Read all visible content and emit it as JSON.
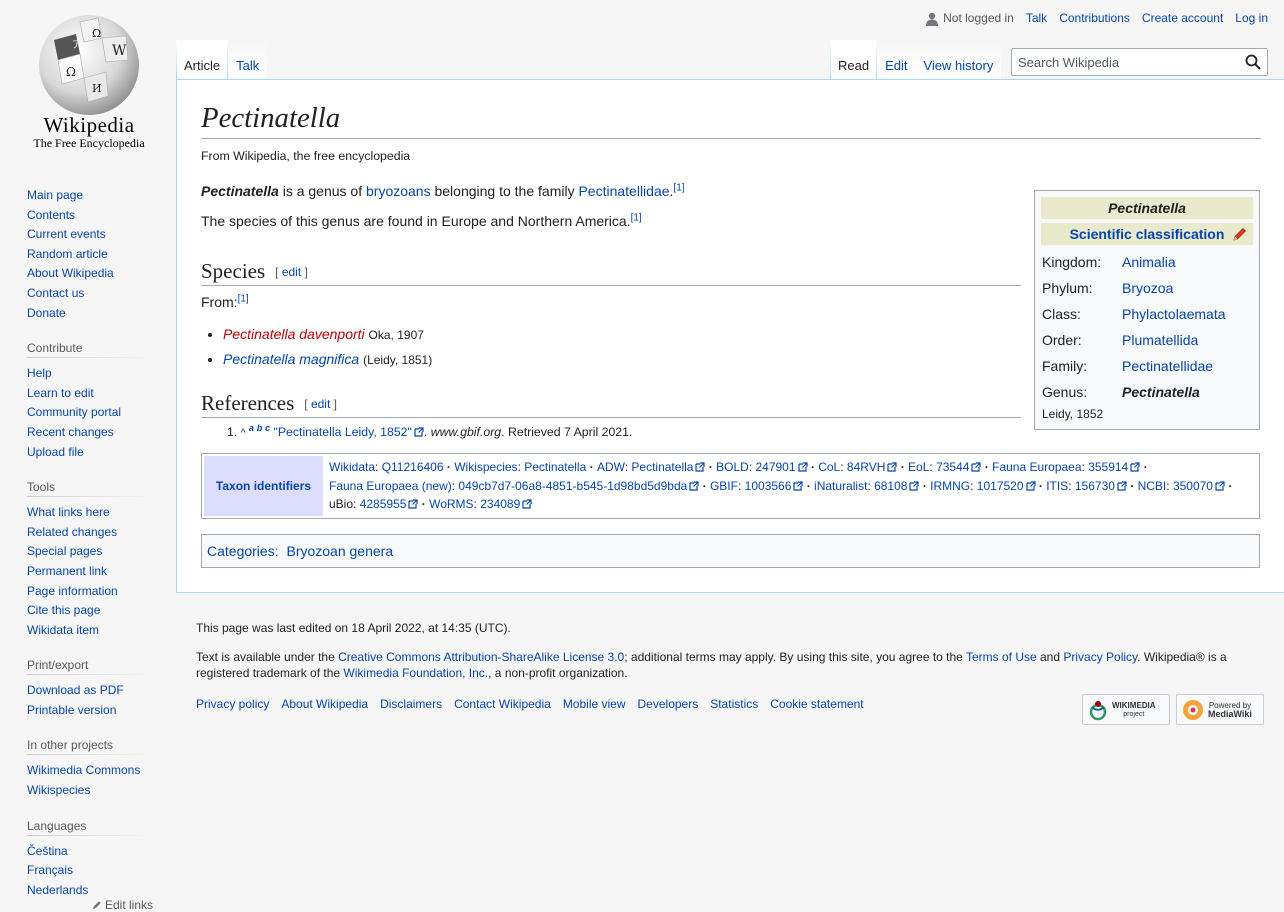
{
  "logo": {
    "wordmark": "Wikipedia",
    "tagline": "The Free Encyclopedia"
  },
  "personal": {
    "not_logged_in": "Not logged in",
    "talk": "Talk",
    "contributions": "Contributions",
    "create_account": "Create account",
    "log_in": "Log in"
  },
  "tabs_left": {
    "article": "Article",
    "talk": "Talk"
  },
  "tabs_right": {
    "read": "Read",
    "edit": "Edit",
    "view_history": "View history"
  },
  "search": {
    "placeholder": "Search Wikipedia"
  },
  "sidebar": {
    "nav": [
      "Main page",
      "Contents",
      "Current events",
      "Random article",
      "About Wikipedia",
      "Contact us",
      "Donate"
    ],
    "contribute": {
      "heading": "Contribute",
      "items": [
        "Help",
        "Learn to edit",
        "Community portal",
        "Recent changes",
        "Upload file"
      ]
    },
    "tools": {
      "heading": "Tools",
      "items": [
        "What links here",
        "Related changes",
        "Special pages",
        "Permanent link",
        "Page information",
        "Cite this page",
        "Wikidata item"
      ]
    },
    "print": {
      "heading": "Print/export",
      "items": [
        "Download as PDF",
        "Printable version"
      ]
    },
    "other": {
      "heading": "In other projects",
      "items": [
        "Wikimedia Commons",
        "Wikispecies"
      ]
    },
    "languages": {
      "heading": "Languages",
      "items": [
        "Čeština",
        "Français",
        "Nederlands"
      ],
      "edit_links": "Edit links"
    }
  },
  "article": {
    "title": "Pectinatella",
    "site_sub": "From Wikipedia, the free encyclopedia",
    "p1": {
      "bold": "Pectinatella",
      "t1": " is a genus of ",
      "link1": "bryozoans",
      "t2": " belonging to the family ",
      "link2": "Pectinatellidae",
      "t3": ".",
      "ref": "[1]"
    },
    "p2": {
      "text": "The species of this genus are found in Europe and Northern America.",
      "ref": "[1]"
    },
    "species": {
      "heading": "Species",
      "edit": "edit",
      "from": "From:",
      "ref": "[1]",
      "items": [
        {
          "name": "Pectinatella davenporti",
          "authority": "Oka, 1907"
        },
        {
          "name": "Pectinatella magnifica",
          "authority": "(Leidy, 1851)"
        }
      ]
    },
    "references": {
      "heading": "References",
      "edit": "edit",
      "item": {
        "num": "1.",
        "caret": "^",
        "a": "a",
        "b": "b",
        "c": "c",
        "title": "\"Pectinatella Leidy, 1852\"",
        "site": "www.gbif.org",
        "retrieved": ". Retrieved 7 April 2021."
      }
    }
  },
  "infobox": {
    "caption": "Pectinatella",
    "sci": "Scientific classification",
    "rows": [
      {
        "k": "Kingdom:",
        "v": "Animalia"
      },
      {
        "k": "Phylum:",
        "v": "Bryozoa"
      },
      {
        "k": "Class:",
        "v": "Phylactolaemata"
      },
      {
        "k": "Order:",
        "v": "Plumatellida"
      },
      {
        "k": "Family:",
        "v": "Pectinatellidae"
      }
    ],
    "genus_k": "Genus:",
    "genus_v": "Pectinatella",
    "authority": "Leidy, 1852"
  },
  "navbox": {
    "group": "Taxon identifiers",
    "entries": [
      {
        "k": "Wikidata",
        "v": "Q11216406",
        "ext": false
      },
      {
        "k": "Wikispecies",
        "v": "Pectinatella",
        "ext": false
      },
      {
        "k": "ADW",
        "v": "Pectinatella",
        "ext": true
      },
      {
        "k": "BOLD",
        "v": "247901",
        "ext": true
      },
      {
        "k": "CoL",
        "v": "84RVH",
        "ext": true
      },
      {
        "k": "EoL",
        "v": "73544",
        "ext": true
      },
      {
        "k": "Fauna Europaea",
        "v": "355914",
        "ext": true
      },
      {
        "k": "Fauna Europaea (new)",
        "v": "049cb7d7-06a8-4851-b545-1d98bd5d9bda",
        "ext": true
      },
      {
        "k": "GBIF",
        "v": "1003566",
        "ext": true
      },
      {
        "k": "iNaturalist",
        "v": "68108",
        "ext": true
      },
      {
        "k": "IRMNG",
        "v": "1017520",
        "ext": true
      },
      {
        "k": "ITIS",
        "v": "156730",
        "ext": true
      },
      {
        "k": "NCBI",
        "v": "350070",
        "ext": true
      },
      {
        "k": "uBio",
        "v": "4285955",
        "ext": true
      },
      {
        "k": "WoRMS",
        "v": "234089",
        "ext": true
      }
    ]
  },
  "categories": {
    "label": "Categories",
    "items": [
      "Bryozoan genera"
    ]
  },
  "footer": {
    "last_edited": "This page was last edited on 18 April 2022, at 14:35 (UTC).",
    "license_t1": "Text is available under the ",
    "license_link": "Creative Commons Attribution-ShareAlike License 3.0",
    "license_t2": "; additional terms may apply. By using this site, you agree to the ",
    "terms": "Terms of Use",
    "and": " and ",
    "privacy": "Privacy Policy",
    "license_t3": ". Wikipedia® is a registered trademark of the ",
    "foundation": "Wikimedia Foundation, Inc.",
    "license_t4": ", a non-profit organization.",
    "links": [
      "Privacy policy",
      "About Wikipedia",
      "Disclaimers",
      "Contact Wikipedia",
      "Mobile view",
      "Developers",
      "Statistics",
      "Cookie statement"
    ],
    "badge1": {
      "t1": "WIKIMEDIA",
      "t2": "project"
    },
    "badge2": {
      "t1": "Powered by",
      "t2": "MediaWiki"
    }
  }
}
